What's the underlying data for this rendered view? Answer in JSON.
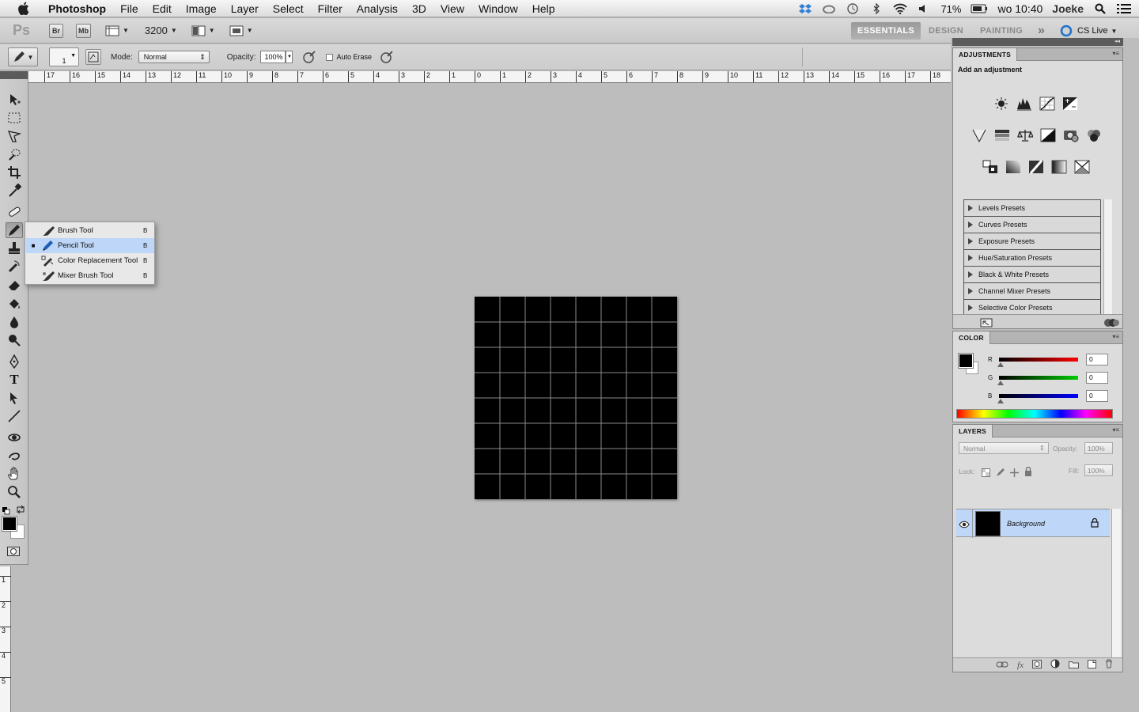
{
  "menubar": {
    "app_name": "Photoshop",
    "items": [
      "File",
      "Edit",
      "Image",
      "Layer",
      "Select",
      "Filter",
      "Analysis",
      "3D",
      "View",
      "Window",
      "Help"
    ],
    "battery": "71%",
    "clock": "wo 10:40",
    "user": "Joeke"
  },
  "appbar": {
    "logo": "Ps",
    "bridge": "Br",
    "mini_bridge": "Mb",
    "zoom": "3200",
    "workspaces": [
      "ESSENTIALS",
      "DESIGN",
      "PAINTING"
    ],
    "more": "»",
    "cs_live": "CS Live"
  },
  "options": {
    "brush_size": "1",
    "mode_label": "Mode:",
    "mode_value": "Normal",
    "opacity_label": "Opacity:",
    "opacity_value": "100%",
    "auto_erase_label": "Auto Erase",
    "auto_erase_checked": false
  },
  "rulers": {
    "top": [
      "17",
      "16",
      "15",
      "14",
      "13",
      "12",
      "11",
      "10",
      "9",
      "8",
      "7",
      "6",
      "5",
      "4",
      "3",
      "2",
      "1",
      "0",
      "1",
      "2",
      "3",
      "4",
      "5",
      "6",
      "7",
      "8",
      "9",
      "10",
      "11",
      "12",
      "13",
      "14",
      "15",
      "16",
      "17",
      "18"
    ],
    "right_tick": "2",
    "left": [
      "1",
      "2",
      "3",
      "4",
      "5"
    ]
  },
  "tools": [
    "move",
    "marquee",
    "lasso",
    "quick-select",
    "crop",
    "eyedropper",
    "healing",
    "brush",
    "stamp",
    "history-brush",
    "eraser",
    "paint-bucket",
    "blur",
    "dodge",
    "pen",
    "type",
    "path-select",
    "line",
    "3d-rotate",
    "3d-orbit",
    "hand",
    "zoom"
  ],
  "flyout": {
    "items": [
      {
        "label": "Brush Tool",
        "key": "B",
        "selected": false
      },
      {
        "label": "Pencil Tool",
        "key": "B",
        "selected": true
      },
      {
        "label": "Color Replacement Tool",
        "key": "B",
        "selected": false
      },
      {
        "label": "Mixer Brush Tool",
        "key": "B",
        "selected": false
      }
    ]
  },
  "canvas": {
    "grid_cols": 8,
    "grid_rows": 8,
    "fill": "#000000",
    "grid_color": "#8a8a8a"
  },
  "adjustments": {
    "tab": "ADJUSTMENTS",
    "subtitle": "Add an adjustment",
    "presets": [
      "Levels Presets",
      "Curves Presets",
      "Exposure Presets",
      "Hue/Saturation Presets",
      "Black & White Presets",
      "Channel Mixer Presets",
      "Selective Color Presets"
    ]
  },
  "color": {
    "tab": "COLOR",
    "channels": [
      {
        "name": "R",
        "value": "0"
      },
      {
        "name": "G",
        "value": "0"
      },
      {
        "name": "B",
        "value": "0"
      }
    ]
  },
  "layers": {
    "tab": "LAYERS",
    "blend_mode": "Normal",
    "opacity_label": "Opacity:",
    "opacity_value": "100%",
    "lock_label": "Lock:",
    "fill_label": "Fill:",
    "fill_value": "100%",
    "layer_name": "Background"
  },
  "colors": {
    "accent_selection": "#bed6f7",
    "canvas_bg": "#bdbdbd"
  }
}
